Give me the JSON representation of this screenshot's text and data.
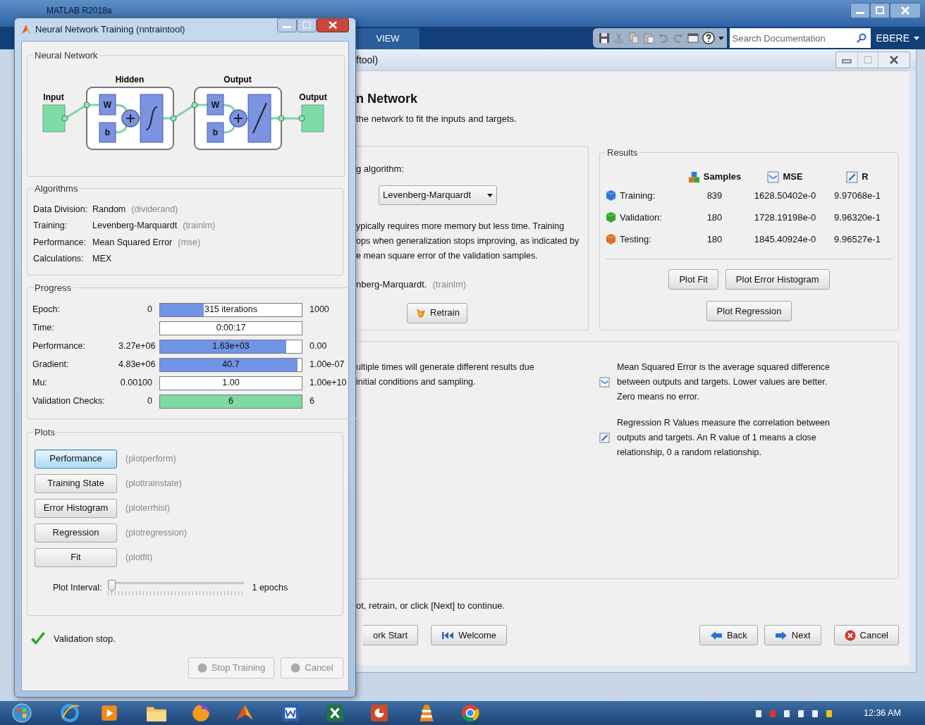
{
  "matlab": {
    "title": "MATLAB R2018a",
    "tab": "VIEW",
    "search": {
      "placeholder": "Search Documentation"
    },
    "user": "EBERE"
  },
  "training": {
    "title": "Neural Network Training (nntraintool)",
    "network": {
      "title": "Neural Network",
      "input": "Input",
      "output": "Output",
      "layers": [
        {
          "title": "Hidden",
          "weight": "W",
          "bias": "b",
          "kind": "sigmoid"
        },
        {
          "title": "Output",
          "weight": "W",
          "bias": "b",
          "kind": "linear"
        }
      ]
    },
    "algorithms": {
      "title": "Algorithms",
      "rows": [
        {
          "label": "Data Division:",
          "value": "Random",
          "func": "(dividerand)"
        },
        {
          "label": "Training:",
          "value": "Levenberg-Marquardt",
          "func": "(trainlm)"
        },
        {
          "label": "Performance:",
          "value": "Mean Squared Error",
          "func": "(mse)"
        },
        {
          "label": "Calculations:",
          "value": "MEX"
        }
      ]
    },
    "progress": {
      "title": "Progress",
      "rows": [
        {
          "label": "Epoch:",
          "start": "0",
          "bar_text": "315 iterations",
          "end": "1000",
          "level": 0.31,
          "color": "#7094e6"
        },
        {
          "label": "Time:",
          "bar_text": "0:00:17",
          "level": 0
        },
        {
          "label": "Performance:",
          "start": "3.27e+06",
          "bar_text": "1.63e+03",
          "end": "0.00",
          "level": 0.89,
          "color": "#7094e6"
        },
        {
          "label": "Gradient:",
          "start": "4.83e+06",
          "bar_text": "40.7",
          "end": "1.00e-07",
          "level": 0.97,
          "color": "#7094e6"
        },
        {
          "label": "Mu:",
          "start": "0.00100",
          "bar_text": "1.00",
          "end": "1.00e+10",
          "level": 0
        },
        {
          "label": "Validation Checks:",
          "start": "0",
          "bar_text": "6",
          "end": "6",
          "level": 1,
          "color": "#7ed9a2"
        }
      ]
    },
    "plots": {
      "title": "Plots",
      "buttons": [
        {
          "label": "Performance",
          "func": "(plotperform)",
          "selected": true
        },
        {
          "label": "Training State",
          "func": "(plottrainstate)",
          "selected": false
        },
        {
          "label": "Error Histogram",
          "func": "(ploterrhist)",
          "selected": false
        },
        {
          "label": "Regression",
          "func": "(plotregression)",
          "selected": false
        },
        {
          "label": "Fit",
          "func": "(plotfit)",
          "selected": false
        }
      ],
      "interval": {
        "label": "Plot Interval:",
        "level": 0,
        "value": "1 epochs"
      }
    },
    "status": "Validation stop.",
    "buttons": [
      {
        "label": "Stop Training",
        "disabled": true
      },
      {
        "label": "Cancel",
        "disabled": true
      }
    ]
  },
  "nftool": {
    "title": "ftool)",
    "heading": "n Network",
    "subtitle": "the network to fit the inputs and targets.",
    "algorithm": {
      "label": "g algorithm:",
      "selected": "Levenberg-Marquardt",
      "description": [
        "ypically requires more memory but less time. Training",
        "ops when generalization stops improving, as indicated by",
        "e mean square error of the validation samples."
      ],
      "note": "nberg-Marquardt.",
      "note_func": "(trainlm)",
      "retrain": "Retrain"
    },
    "results": {
      "title": "Results",
      "columns": [
        {
          "label": "Samples",
          "kind": "samples"
        },
        {
          "label": "MSE",
          "kind": "mse"
        },
        {
          "label": "R",
          "kind": "r"
        }
      ],
      "rows": [
        {
          "label": "Training:",
          "samples": "839",
          "mse": "1628.50402e-0",
          "r": "9.97068e-1",
          "color": "#2f78d8"
        },
        {
          "label": "Validation:",
          "samples": "180",
          "mse": "1728.19198e-0",
          "r": "9.96320e-1",
          "color": "#2fa82f"
        },
        {
          "label": "Testing:",
          "samples": "180",
          "mse": "1845.40924e-0",
          "r": "9.96527e-1",
          "color": "#e0701f"
        }
      ],
      "buttons": [
        "Plot Fit",
        "Plot Error Histogram",
        "Plot Regression"
      ]
    },
    "notes_left": [
      "ultiple times will generate different results due",
      "initial conditions and sampling."
    ],
    "notes": [
      {
        "kind": "mse",
        "text": "Mean Squared Error is the average squared difference between outputs and targets. Lower values are better. Zero means no error."
      },
      {
        "kind": "r",
        "text": "Regression R Values measure the correlation between outputs and targets. An R value of 1 means a close relationship, 0 a random relationship."
      }
    ],
    "instruction": "ot, retrain, or click [Next] to continue.",
    "buttons": [
      {
        "label": "ork Start",
        "kind": "plain"
      },
      {
        "label": "Welcome",
        "kind": "welcome"
      },
      {
        "label": "Back",
        "kind": "back"
      },
      {
        "label": "Next",
        "kind": "next"
      },
      {
        "label": "Cancel",
        "kind": "cancel"
      }
    ]
  },
  "taskbar": {
    "time": "12:36 AM"
  }
}
